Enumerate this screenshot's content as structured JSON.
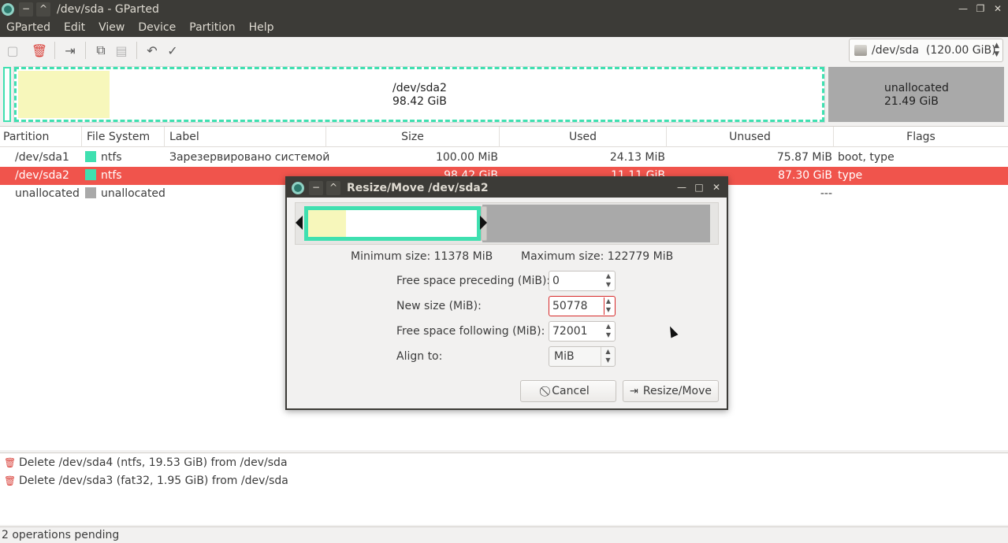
{
  "window": {
    "title": "/dev/sda - GParted"
  },
  "menubar": {
    "items": [
      "GParted",
      "Edit",
      "View",
      "Device",
      "Partition",
      "Help"
    ]
  },
  "toolbar": {
    "device_selector": "/dev/sda  (120.00 GiB)"
  },
  "disk_map": {
    "sda2_name": "/dev/sda2",
    "sda2_size": "98.42 GiB",
    "unallocated_name": "unallocated",
    "unallocated_size": "21.49 GiB"
  },
  "table": {
    "headers": [
      "Partition",
      "File System",
      "Label",
      "Size",
      "Used",
      "Unused",
      "Flags"
    ],
    "rows": [
      {
        "partition": "/dev/sda1",
        "filesystem": "ntfs",
        "fs_color": "#3fe0b0",
        "label": "Зарезервировано системой",
        "size": "100.00 MiB",
        "used": "24.13 MiB",
        "unused": "75.87 MiB",
        "flags": "boot, type"
      },
      {
        "partition": "/dev/sda2",
        "filesystem": "ntfs",
        "fs_color": "#3fe0b0",
        "label": "",
        "size": "98.42 GiB",
        "used": "11.11 GiB",
        "unused": "87.30 GiB",
        "flags": "type"
      },
      {
        "partition": "unallocated",
        "filesystem": "unallocated",
        "fs_color": "#a9a9a9",
        "label": "",
        "size": "",
        "used": "",
        "unused": "---",
        "flags": ""
      }
    ]
  },
  "operations": [
    "Delete /dev/sda4 (ntfs, 19.53 GiB) from /dev/sda",
    "Delete /dev/sda3 (fat32, 1.95 GiB) from /dev/sda"
  ],
  "statusbar": {
    "text": "2 operations pending"
  },
  "dialog": {
    "title": "Resize/Move /dev/sda2",
    "min_size": "Minimum size: 11378 MiB",
    "max_size": "Maximum size: 122779 MiB",
    "free_preceding_label": "Free space preceding (MiB):",
    "free_preceding_value": "0",
    "new_size_label": "New size (MiB):",
    "new_size_value": "50778",
    "free_following_label": "Free space following (MiB):",
    "free_following_value": "72001",
    "align_label": "Align to:",
    "align_value": "MiB",
    "cancel_label": "Cancel",
    "resize_label": "Resize/Move"
  }
}
